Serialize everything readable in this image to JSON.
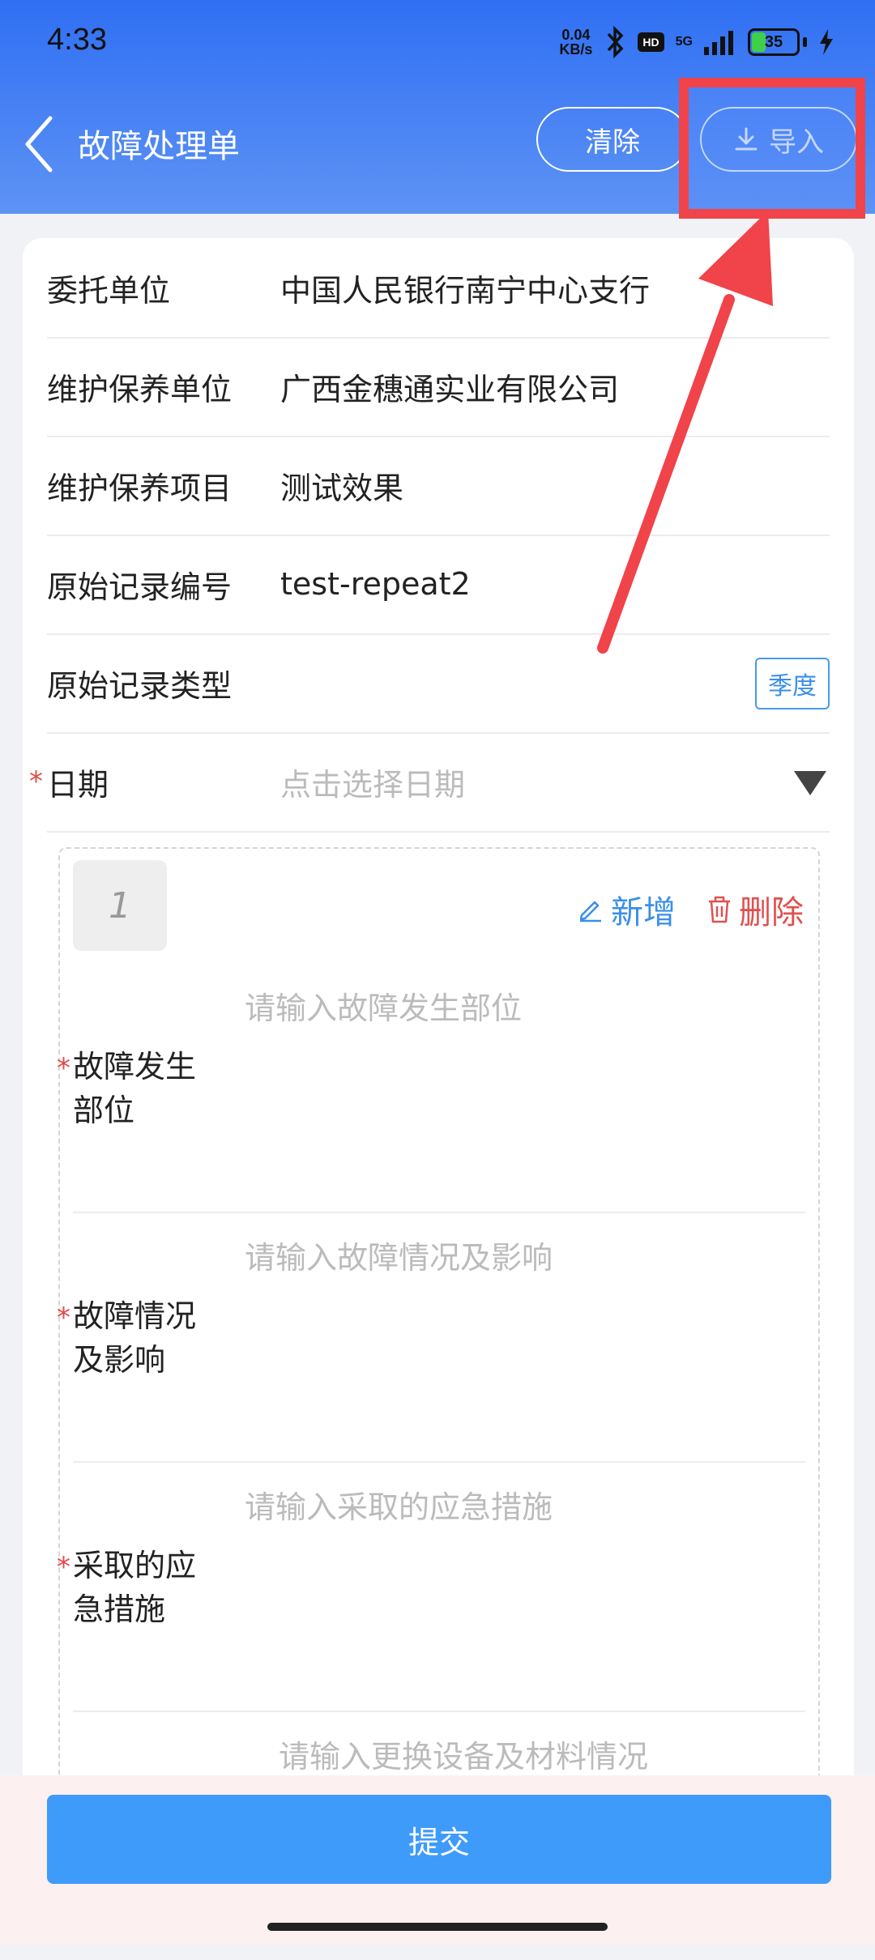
{
  "status": {
    "time": "4:33",
    "net_speed_top": "0.04",
    "net_speed_bottom": "KB/s",
    "hd": "HD",
    "signal": "5G",
    "battery": "35"
  },
  "header": {
    "title": "故障处理单",
    "clear_label": "清除",
    "import_label": "导入"
  },
  "form": {
    "rows": [
      {
        "label": "委托单位",
        "value": "中国人民银行南宁中心支行"
      },
      {
        "label": "维护保养单位",
        "value": "广西金穗通实业有限公司"
      },
      {
        "label": "维护保养项目",
        "value": "测试效果"
      },
      {
        "label": "原始记录编号",
        "value": "test-repeat2"
      },
      {
        "label": "原始记录类型",
        "tag": "季度"
      },
      {
        "label": "日期",
        "placeholder": "点击选择日期",
        "required": "*"
      }
    ]
  },
  "group": {
    "index": "1",
    "add_label": "新增",
    "delete_label": "删除",
    "fields": [
      {
        "label_line1": "故障发生",
        "label_line2": "部位",
        "placeholder": "请输入故障发生部位",
        "required": "*"
      },
      {
        "label_line1": "故障情况",
        "label_line2": "及影响",
        "placeholder": "请输入故障情况及影响",
        "required": "*"
      },
      {
        "label_line1": "采取的应",
        "label_line2": "急措施",
        "placeholder": "请输入采取的应急措施",
        "required": "*"
      },
      {
        "placeholder": "请输入更换设备及材料情况"
      }
    ]
  },
  "footer": {
    "submit_label": "提交"
  },
  "colors": {
    "header_top": "#2f6ff3",
    "header_bottom": "#5e93f5",
    "primary": "#3f9bfa",
    "tag_blue": "#3a8fe6",
    "danger": "#e05050",
    "highlight_red": "#f0434a"
  }
}
